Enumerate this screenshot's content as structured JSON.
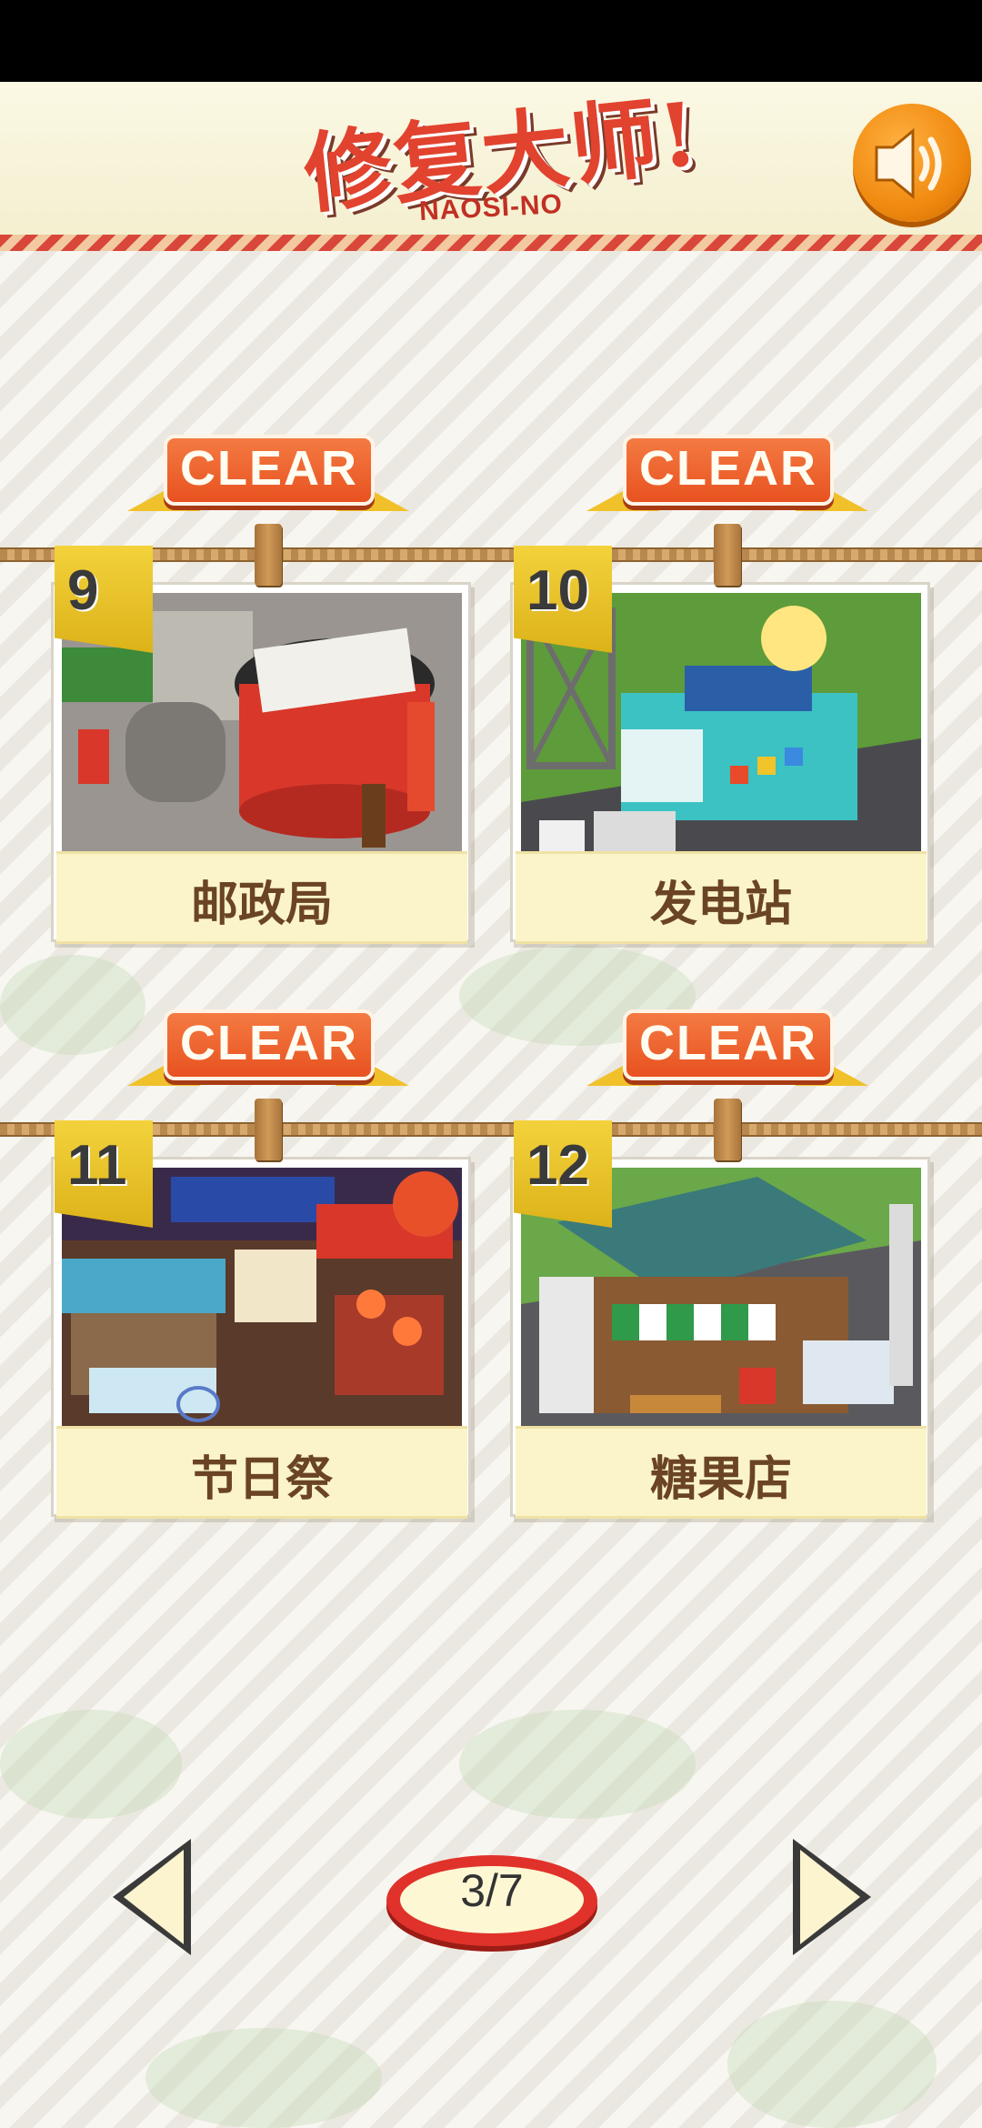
{
  "header": {
    "logo_cn": "修复大师!",
    "logo_en": "NAOSI-NO",
    "sound_icon": "speaker-icon"
  },
  "levels": [
    {
      "number": "9",
      "name": "邮政局",
      "status": "CLEAR",
      "scene": "post-office"
    },
    {
      "number": "10",
      "name": "发电站",
      "status": "CLEAR",
      "scene": "power-station"
    },
    {
      "number": "11",
      "name": "节日祭",
      "status": "CLEAR",
      "scene": "festival"
    },
    {
      "number": "12",
      "name": "糖果店",
      "status": "CLEAR",
      "scene": "candy-shop"
    }
  ],
  "pagination": {
    "page_label": "3/7",
    "prev_icon": "triangle-left-icon",
    "next_icon": "triangle-right-icon"
  },
  "colors": {
    "accent_orange": "#e85220",
    "tag_yellow": "#f3d23c",
    "label_brown": "#6a4424",
    "badge_red": "#e0322a"
  }
}
